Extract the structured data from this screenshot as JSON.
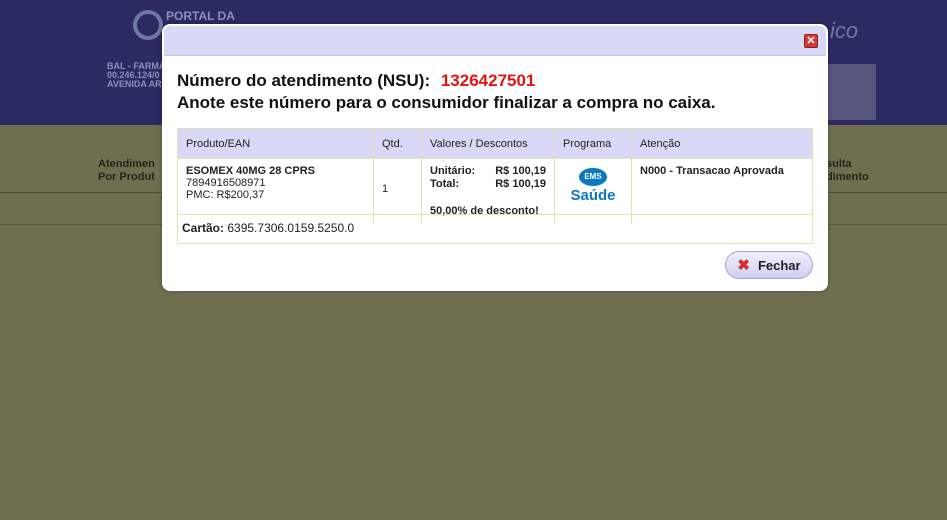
{
  "background": {
    "logo_text": "PORTAL DA",
    "tagline_fragment": "ico",
    "pharmacy_lines": [
      "BAL - FARMA",
      "00.246.124/0",
      "AVENIDA ARA"
    ],
    "nav_left": [
      "Atendimen",
      "Por Produt"
    ],
    "nav_right": [
      "sulta",
      "dimento"
    ]
  },
  "modal": {
    "nsu_label": "Número do atendimento (NSU):",
    "nsu_value": "1326427501",
    "note": "Anote este número para o consumidor finalizar a compra no caixa.",
    "table": {
      "headers": [
        "Produto/EAN",
        "Qtd.",
        "Valores / Descontos",
        "Programa",
        "Atenção"
      ],
      "row": {
        "product_name": "ESOMEX 40MG 28 CPRS",
        "ean": "7894916508971",
        "pmc": "PMC: R$200,37",
        "qty": "1",
        "unit_label": "Unitário:",
        "unit_value": "R$ 100,19",
        "total_label": "Total:",
        "total_value": "R$ 100,19",
        "discount": "50,00% de desconto!",
        "program_logo_top": "EMS",
        "program_logo_bottom": "Saúde",
        "attention": "N000 - Transacao Aprovada"
      }
    },
    "card_label": "Cartão:",
    "card_value": "6395.7306.0159.5250.0",
    "close_button": "Fechar",
    "close_icon": "close-icon"
  },
  "colors": {
    "header_bg": "#2c2a63",
    "overlay_bg": "#6f6e4f",
    "nsu_color": "#e01414",
    "approved_color": "#1c8a1c",
    "ems_blue": "#0b79bf"
  }
}
